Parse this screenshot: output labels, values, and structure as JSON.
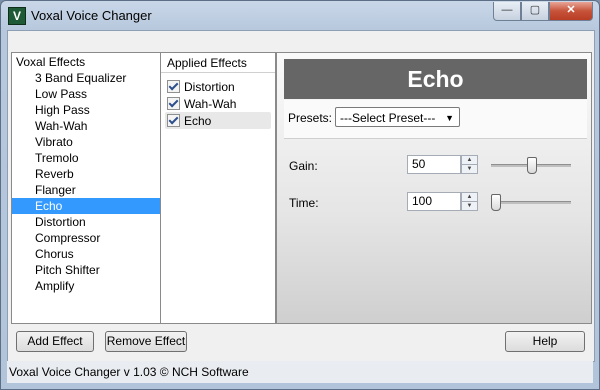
{
  "window": {
    "title": "Voxal Voice Changer",
    "icon_letter": "V",
    "controls": {
      "minimize": "—",
      "maximize": "▢",
      "close": "✕"
    }
  },
  "effects_panel": {
    "header": "Voxal Effects",
    "items": [
      "3 Band Equalizer",
      "Low Pass",
      "High Pass",
      "Wah-Wah",
      "Vibrato",
      "Tremolo",
      "Reverb",
      "Flanger",
      "Echo",
      "Distortion",
      "Compressor",
      "Chorus",
      "Pitch Shifter",
      "Amplify"
    ],
    "selected": "Echo"
  },
  "applied_panel": {
    "header": "Applied Effects",
    "items": [
      {
        "label": "Distortion",
        "checked": true
      },
      {
        "label": "Wah-Wah",
        "checked": true
      },
      {
        "label": "Echo",
        "checked": true
      }
    ]
  },
  "settings": {
    "effect_name": "Echo",
    "presets_label": "Presets:",
    "presets_value": "---Select Preset---",
    "gain": {
      "label": "Gain:",
      "value": "50",
      "slider_fraction": 0.5
    },
    "time": {
      "label": "Time:",
      "value": "100",
      "slider_fraction": 0.0
    }
  },
  "buttons": {
    "add": "Add Effect",
    "remove": "Remove Effect",
    "help": "Help"
  },
  "status": "Voxal Voice Changer v 1.03 © NCH Software"
}
